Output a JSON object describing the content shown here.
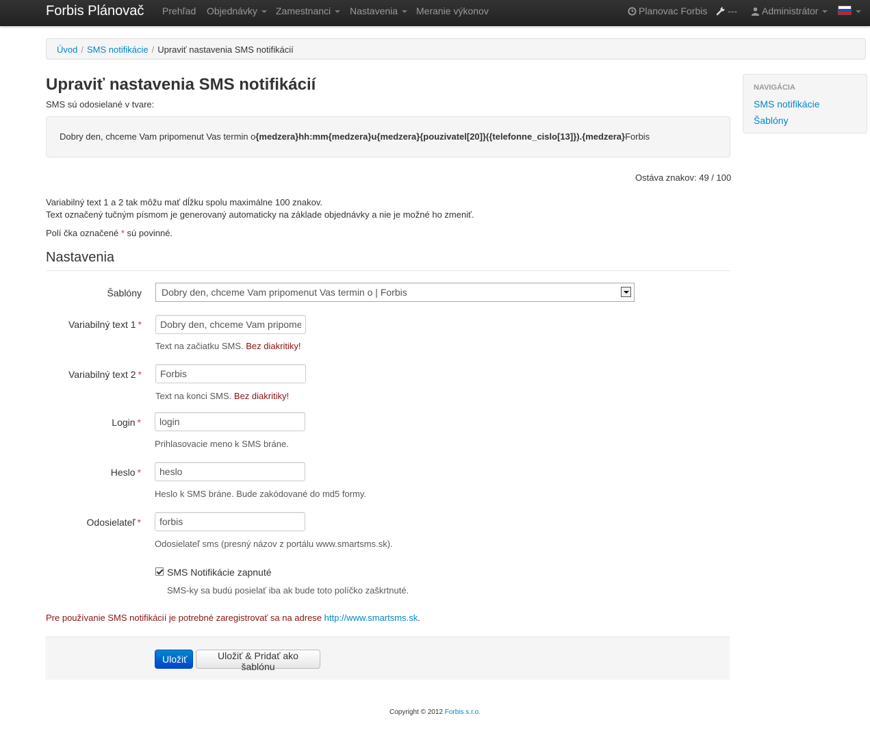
{
  "navbar": {
    "brand": "Forbis Plánovač",
    "items": [
      "Prehľad",
      "Objednávky",
      "Zamestnanci",
      "Nastavenia",
      "Meranie výkonov"
    ],
    "right": {
      "planovac": "Planovac Forbis",
      "tools": "---",
      "user": "Administrátor"
    }
  },
  "breadcrumb": {
    "home": "Úvod",
    "parent": "SMS notifikácie",
    "current": "Upraviť nastavenia SMS notifikácií",
    "separator": "/"
  },
  "page": {
    "title": "Upraviť nastavenia SMS notifikácií",
    "intro": "SMS sú odosielané v tvare:",
    "preview": {
      "part1": "Dobry den, chceme Vam pripomenut Vas termin o",
      "bold1": "{medzera}hh:mm{medzera}u{medzera}{pouzivatel[20]}({telefonne_cislo[13]}).{medzera}",
      "part2": "Forbis"
    },
    "remaining_label": "Ostáva znakov:",
    "remaining_value": "49 / 100",
    "info1": "Variabilný text 1 a 2 tak môžu mať dĺžku spolu maximálne 100 znakov.",
    "info2": "Text označený tučným písmom je generovaný automaticky na základe objednávky a nie je možné ho zmeniť.",
    "required_pre": "Polí čka označené",
    "required_star": "*",
    "required_post": "sú povinné."
  },
  "form": {
    "section_title": "Nastavenia",
    "sablony": {
      "label": "Šablóny",
      "value": "Dobry den, chceme Vam pripomenut Vas termin o | Forbis"
    },
    "var1": {
      "label": "Variabilný text 1",
      "value": "Dobry den, chceme Vam pripomenut Vas termin o",
      "help": "Text na začiatku SMS.",
      "warn": "Bez diakritiky!"
    },
    "var2": {
      "label": "Variabilný text 2",
      "value": "Forbis",
      "help": "Text na konci SMS.",
      "warn": "Bez diakritiky!"
    },
    "login": {
      "label": "Login",
      "value": "login",
      "help": "Prihlasovacie meno k SMS bráne."
    },
    "heslo": {
      "label": "Heslo",
      "value": "heslo",
      "help": "Heslo k SMS bráne. Bude zakódované do md5 formy."
    },
    "sender": {
      "label": "Odosielateľ",
      "value": "forbis",
      "help": "Odosielateľ sms (presný názov z portálu www.smartsms.sk)."
    },
    "enabled": {
      "label": "SMS Notifikácie zapnuté",
      "help": "SMS-ky sa budú posielať iba ak bude toto políčko zaškrtnuté.",
      "checked": true
    },
    "star": "*"
  },
  "note": {
    "text": "Pre používanie SMS notifikácií je potrebné zaregistrovať sa na adrese",
    "link": "http://www.smartsms.sk",
    "end": "."
  },
  "actions": {
    "save": "Uložiť",
    "save_template": "Uložiť & Pridať ako šablónu"
  },
  "sidebar": {
    "header": "Navigácia",
    "links": [
      "SMS notifikácie",
      "Šablóny"
    ]
  },
  "footer": {
    "text": "Copyright © 2012",
    "link": "Forbis s.r.o."
  },
  "colors": {
    "link": "#0088cc",
    "error": "#8a1212",
    "primary": "#0044cc",
    "navbar": "#222222"
  }
}
